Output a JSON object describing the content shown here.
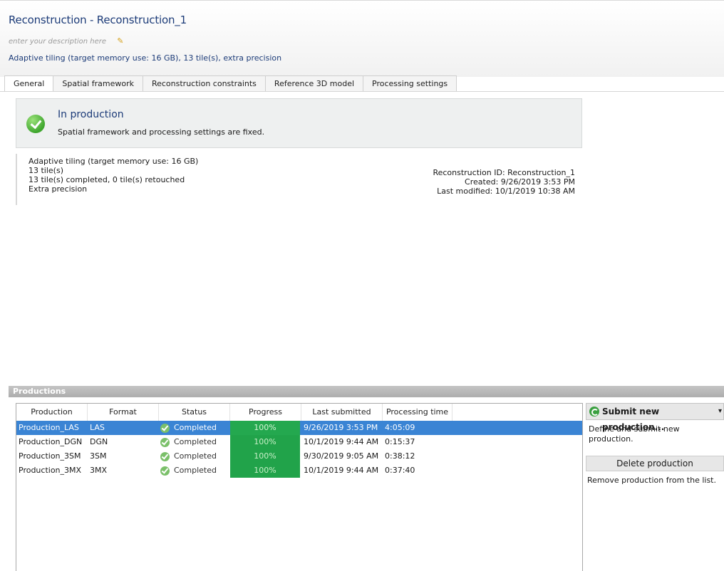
{
  "header": {
    "title": "Reconstruction - Reconstruction_1",
    "description_placeholder": "enter your description here",
    "summary": "Adaptive tiling (target memory use: 16 GB), 13 tile(s), extra precision"
  },
  "tabs": [
    {
      "label": "General",
      "active": true
    },
    {
      "label": "Spatial framework",
      "active": false
    },
    {
      "label": "Reconstruction constraints",
      "active": false
    },
    {
      "label": "Reference 3D model",
      "active": false
    },
    {
      "label": "Processing settings",
      "active": false
    }
  ],
  "status": {
    "title": "In production",
    "subtitle": "Spatial framework and processing settings are fixed."
  },
  "info": {
    "lines": [
      "Adaptive tiling (target memory use: 16 GB)",
      "13 tile(s)",
      "13 tile(s) completed, 0 tile(s) retouched",
      "Extra precision"
    ],
    "reconstruction_id": "Reconstruction ID: Reconstruction_1",
    "created": "Created: 9/26/2019 3:53 PM",
    "last_modified": "Last modified: 10/1/2019 10:38 AM"
  },
  "productions": {
    "section_title": "Productions",
    "columns": [
      "Production",
      "Format",
      "Status",
      "Progress",
      "Last submitted",
      "Processing time"
    ],
    "rows": [
      {
        "name": "Production_LAS",
        "format": "LAS",
        "status": "Completed",
        "progress": "100%",
        "last_submitted": "9/26/2019 3:53 PM",
        "processing_time": "4:05:09",
        "selected": true
      },
      {
        "name": "Production_DGN",
        "format": "DGN",
        "status": "Completed",
        "progress": "100%",
        "last_submitted": "10/1/2019 9:44 AM",
        "processing_time": "0:15:37",
        "selected": false
      },
      {
        "name": "Production_3SM",
        "format": "3SM",
        "status": "Completed",
        "progress": "100%",
        "last_submitted": "9/30/2019 9:05 AM",
        "processing_time": "0:38:12",
        "selected": false
      },
      {
        "name": "Production_3MX",
        "format": "3MX",
        "status": "Completed",
        "progress": "100%",
        "last_submitted": "10/1/2019 9:44 AM",
        "processing_time": "0:37:40",
        "selected": false
      }
    ]
  },
  "actions": {
    "submit_label": "Submit new production...",
    "submit_desc": "Define and submit new production.",
    "delete_label": "Delete production",
    "delete_desc": "Remove production from the list."
  },
  "colors": {
    "title": "#1c3b78",
    "selection": "#3a84d4",
    "progress": "#21a34a",
    "success": "#3fa62e"
  }
}
